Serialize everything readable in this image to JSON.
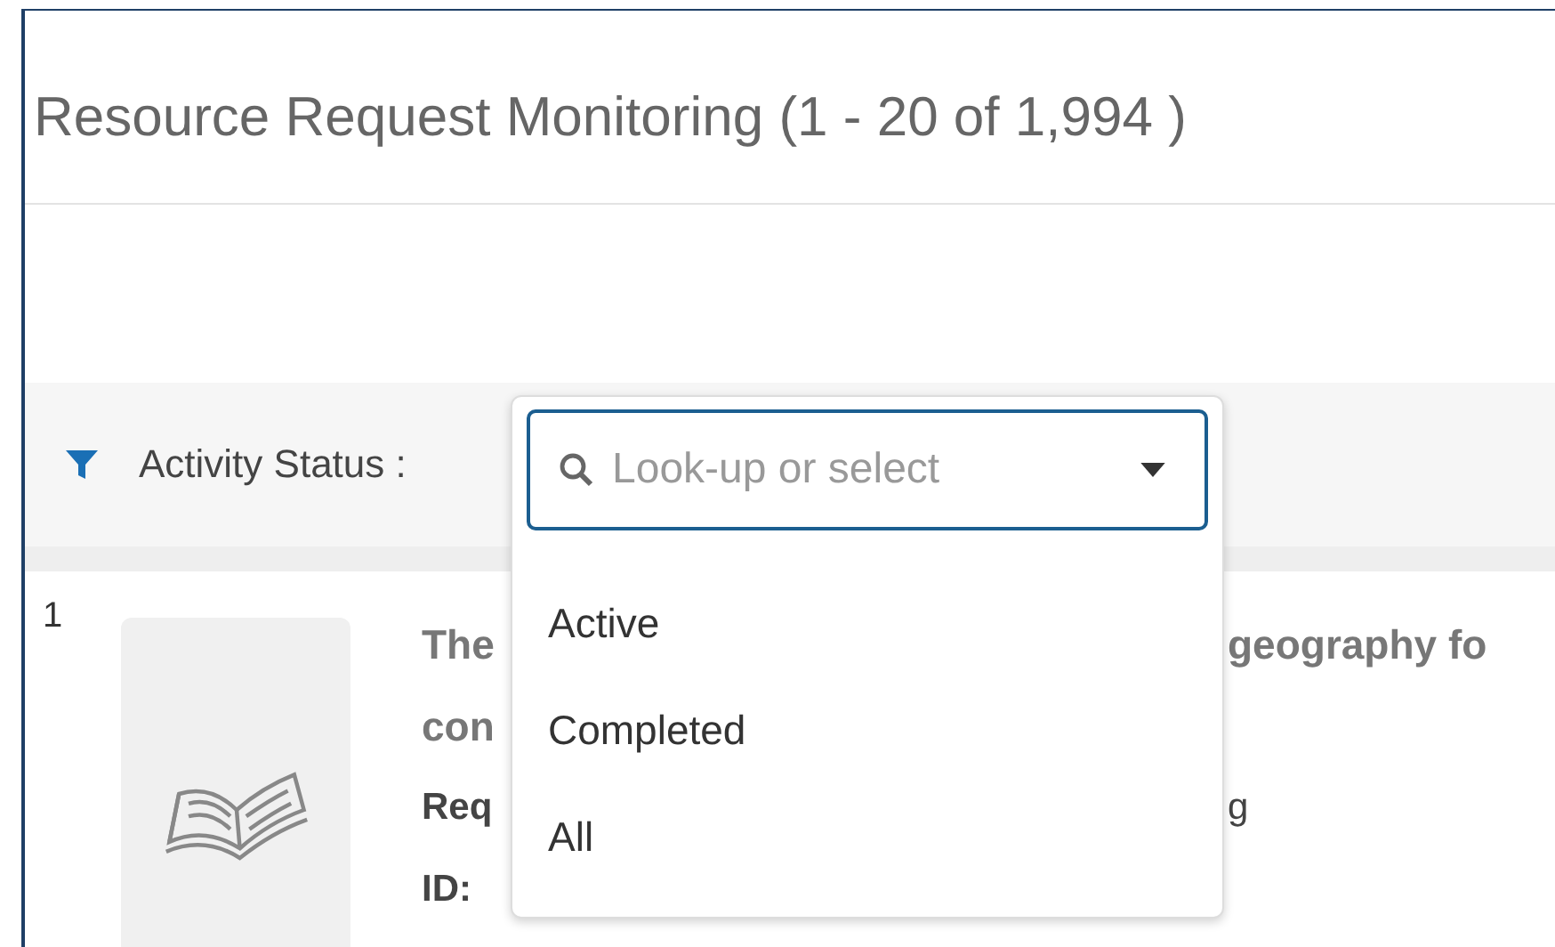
{
  "page": {
    "title": "Resource Request Monitoring (1 - 20 of 1,994 )"
  },
  "filter": {
    "label": "Activity Status :",
    "placeholder": "Look-up or select",
    "expanded": true,
    "options": [
      {
        "label": "Active",
        "selected": false
      },
      {
        "label": "Completed",
        "selected": false
      },
      {
        "label": "All",
        "selected": false
      }
    ]
  },
  "results": [
    {
      "number": "1",
      "lines": [
        {
          "kind": "title",
          "left": "The",
          "right": "geography fo"
        },
        {
          "kind": "title",
          "left": "con"
        },
        {
          "kind": "field",
          "left": "Req",
          "right": "g"
        },
        {
          "kind": "field",
          "left": "ID:"
        }
      ]
    }
  ]
}
